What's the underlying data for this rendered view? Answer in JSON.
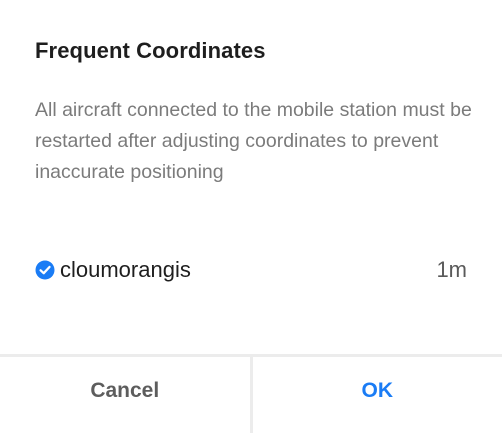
{
  "dialog": {
    "title": "Frequent Coordinates",
    "message": "All aircraft connected to the mobile station must be restarted after adjusting coordinates to prevent inaccurate positioning",
    "option": {
      "icon": "check-circle-icon",
      "label": "cloumorangis",
      "value": "1m",
      "selected": true
    },
    "cancel_label": "Cancel",
    "ok_label": "OK"
  },
  "colors": {
    "accent": "#1a7cf5",
    "title": "#1e1e1e",
    "message": "#7b7b7b",
    "divider": "#ececec"
  }
}
